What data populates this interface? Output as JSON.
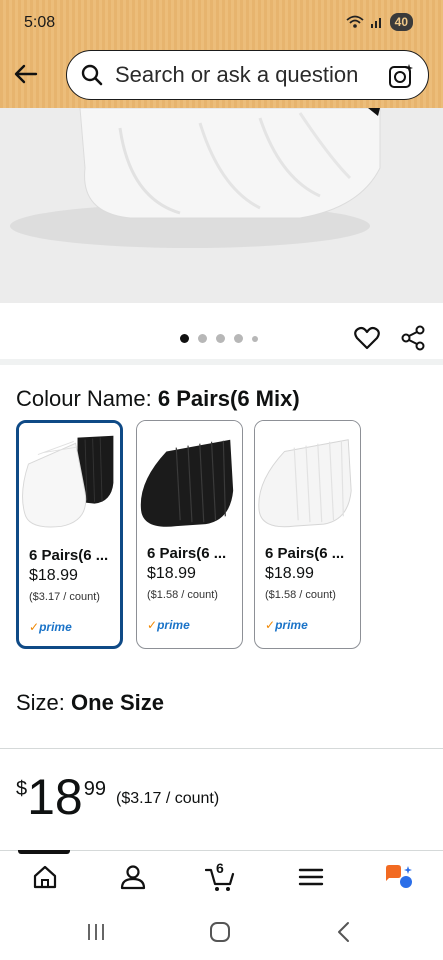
{
  "status": {
    "time": "5:08",
    "battery": "40"
  },
  "header": {
    "search_placeholder": "Search or ask a question"
  },
  "gallery": {
    "dot_count": 5,
    "active_dot": 0
  },
  "colour": {
    "label": "Colour Name:",
    "value": "6 Pairs(6 Mix)",
    "options": [
      {
        "name": "6 Pairs(6 ...",
        "price": "$18.99",
        "unit": "($3.17 / count)",
        "prime": "prime",
        "selected": true
      },
      {
        "name": "6 Pairs(6 ...",
        "price": "$18.99",
        "unit": "($1.58 / count)",
        "prime": "prime",
        "selected": false
      },
      {
        "name": "6 Pairs(6 ...",
        "price": "$18.99",
        "unit": "($1.58 / count)",
        "prime": "prime",
        "selected": false
      }
    ]
  },
  "size": {
    "label": "Size:",
    "value": "One Size"
  },
  "price": {
    "currency": "$",
    "whole": "18",
    "fraction": "99",
    "per_unit": "($3.17 / count)"
  },
  "tabs": {
    "cart_count": "6"
  },
  "colors": {
    "header_bg": "#e7b46e",
    "selected_border": "#0f4a86",
    "prime_blue": "#1a73c8",
    "prime_check": "#f08804"
  }
}
